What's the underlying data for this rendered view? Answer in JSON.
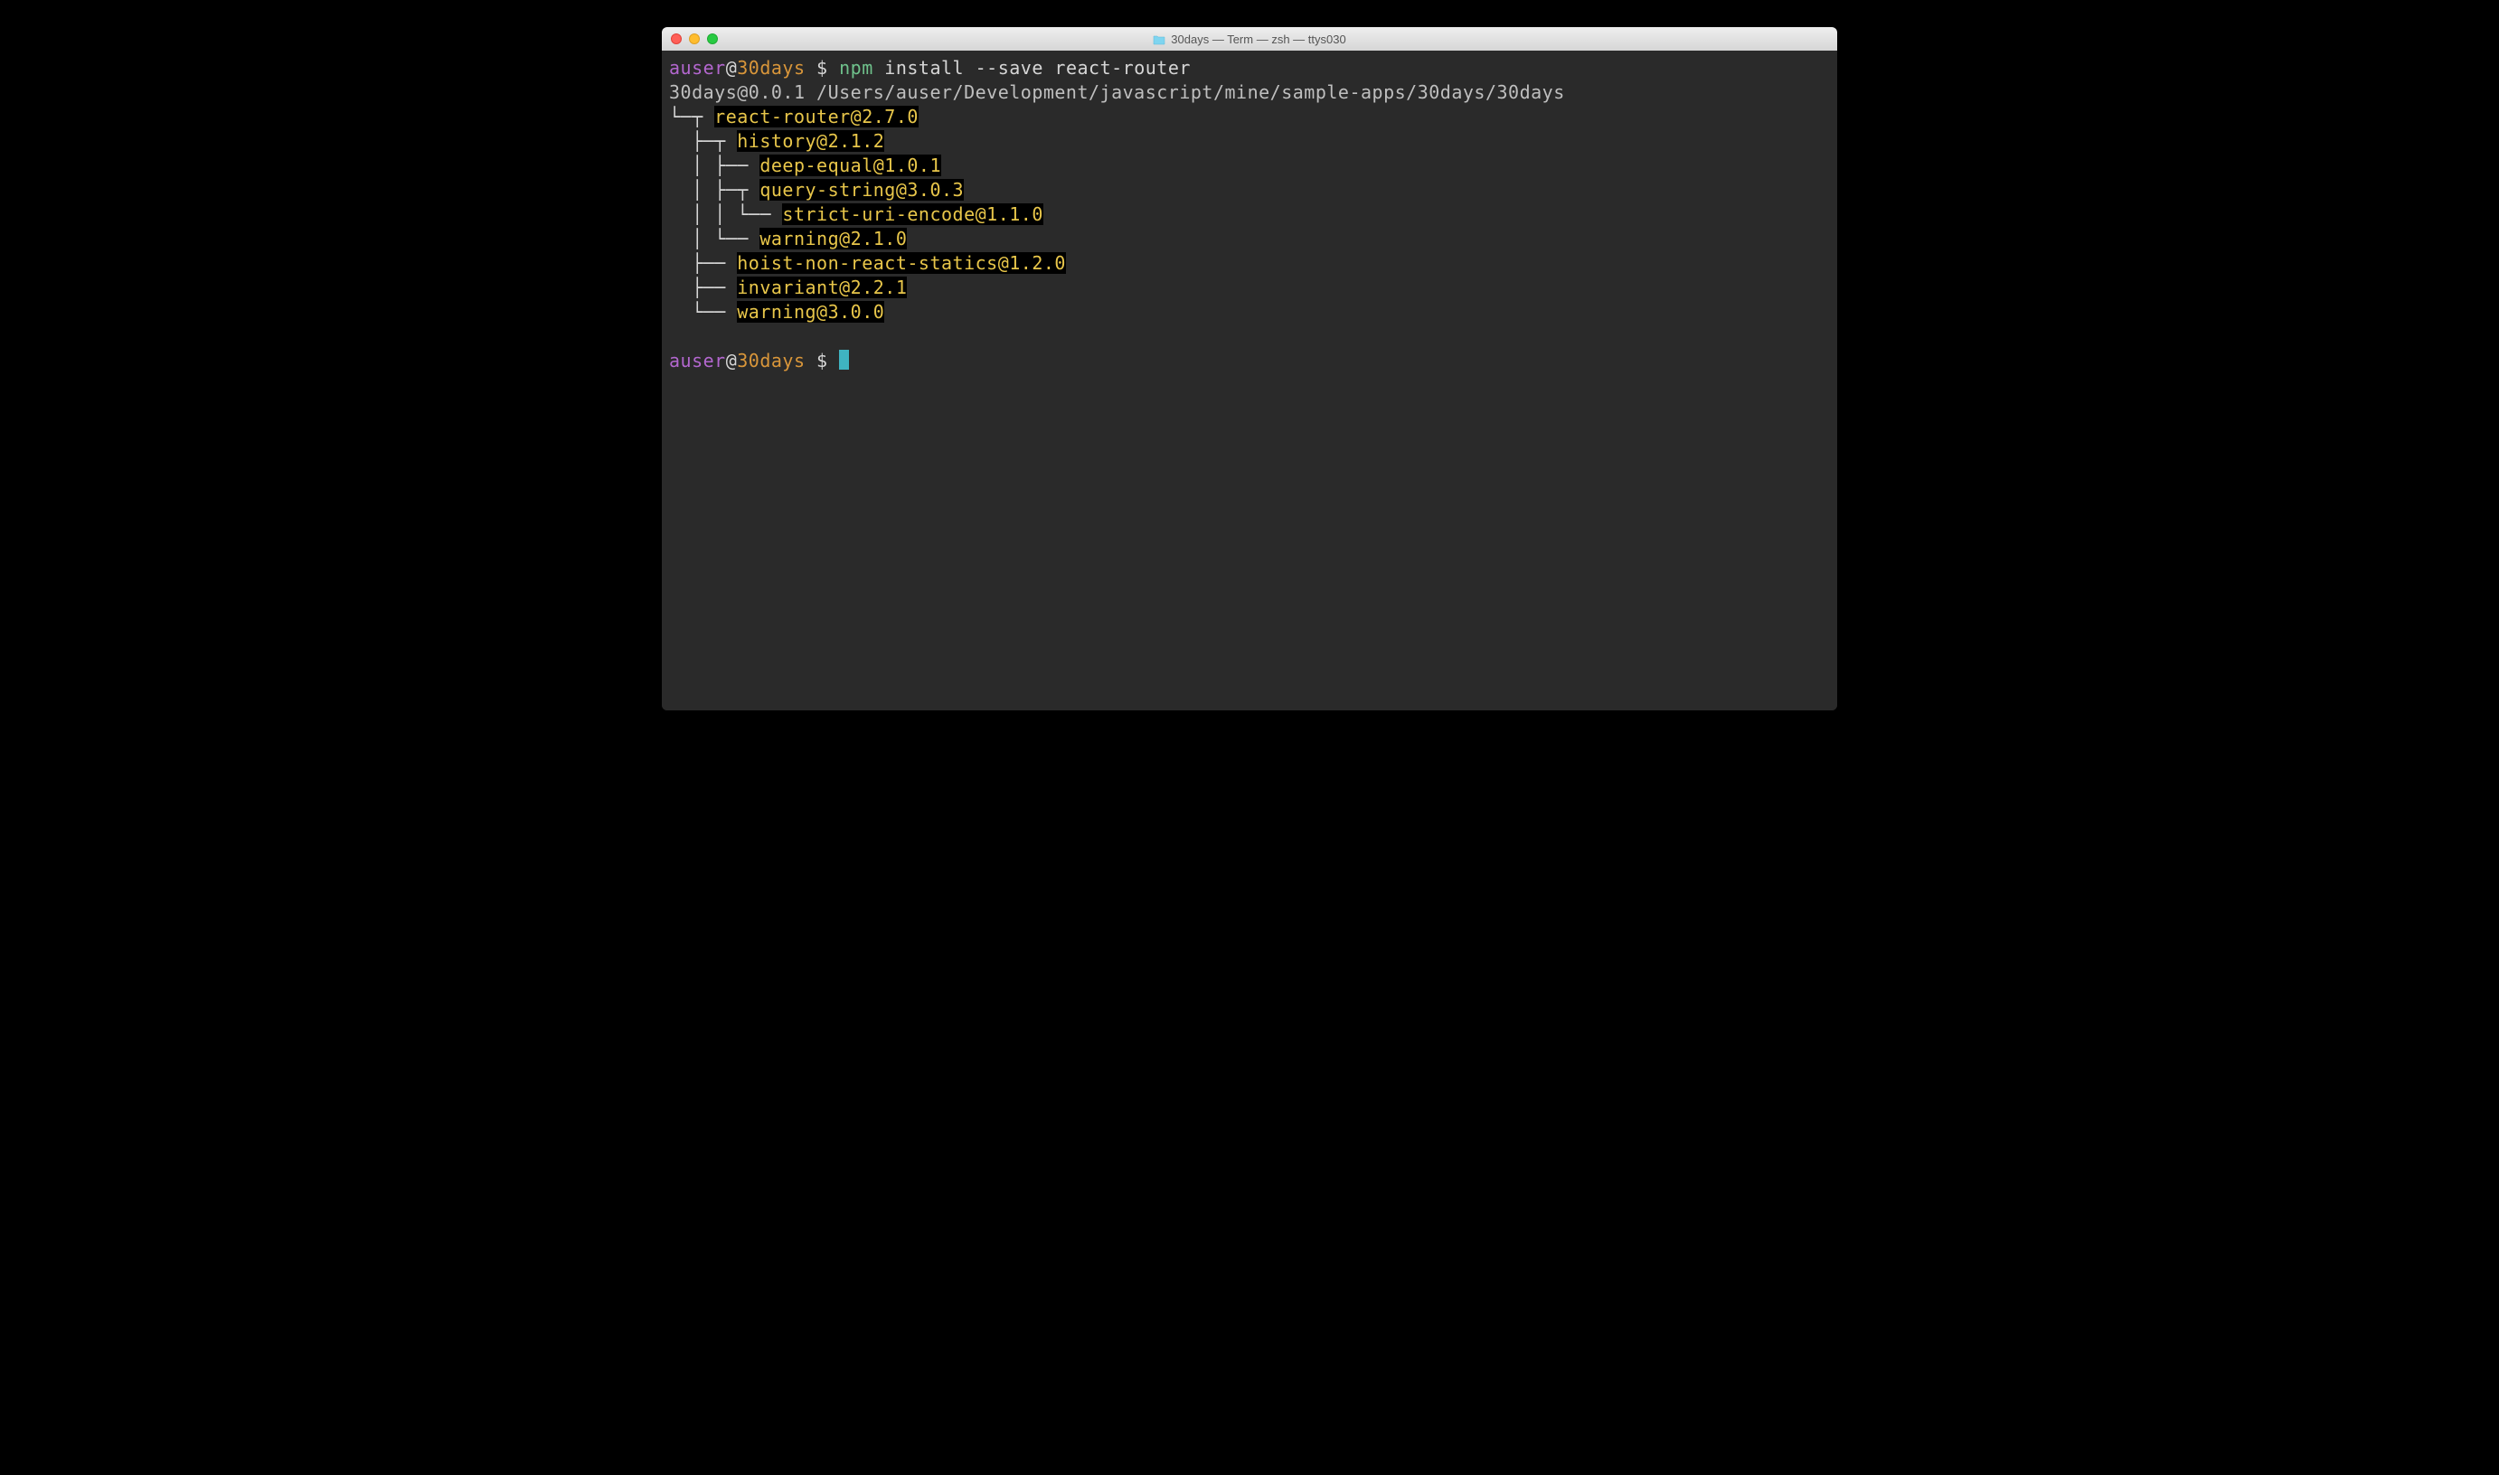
{
  "window": {
    "title": "30days — Term — zsh — ttys030"
  },
  "prompt": {
    "user": "auser",
    "at": "@",
    "host": "30days",
    "dollar": " $ ",
    "command": "npm",
    "args": " install --save react-router"
  },
  "output": {
    "header": "30days@0.0.1 /Users/auser/Development/javascript/mine/sample-apps/30days/30days",
    "tree": [
      {
        "prefix": "└─┬ ",
        "pkg": "react-router@2.7.0"
      },
      {
        "prefix": "  ├─┬ ",
        "pkg": "history@2.1.2"
      },
      {
        "prefix": "  │ ├── ",
        "pkg": "deep-equal@1.0.1"
      },
      {
        "prefix": "  │ ├─┬ ",
        "pkg": "query-string@3.0.3"
      },
      {
        "prefix": "  │ │ └── ",
        "pkg": "strict-uri-encode@1.1.0"
      },
      {
        "prefix": "  │ └── ",
        "pkg": "warning@2.1.0"
      },
      {
        "prefix": "  ├── ",
        "pkg": "hoist-non-react-statics@1.2.0"
      },
      {
        "prefix": "  ├── ",
        "pkg": "invariant@2.2.1"
      },
      {
        "prefix": "  └── ",
        "pkg": "warning@3.0.0"
      }
    ]
  },
  "prompt2": {
    "user": "auser",
    "at": "@",
    "host": "30days",
    "dollar": " $ "
  }
}
